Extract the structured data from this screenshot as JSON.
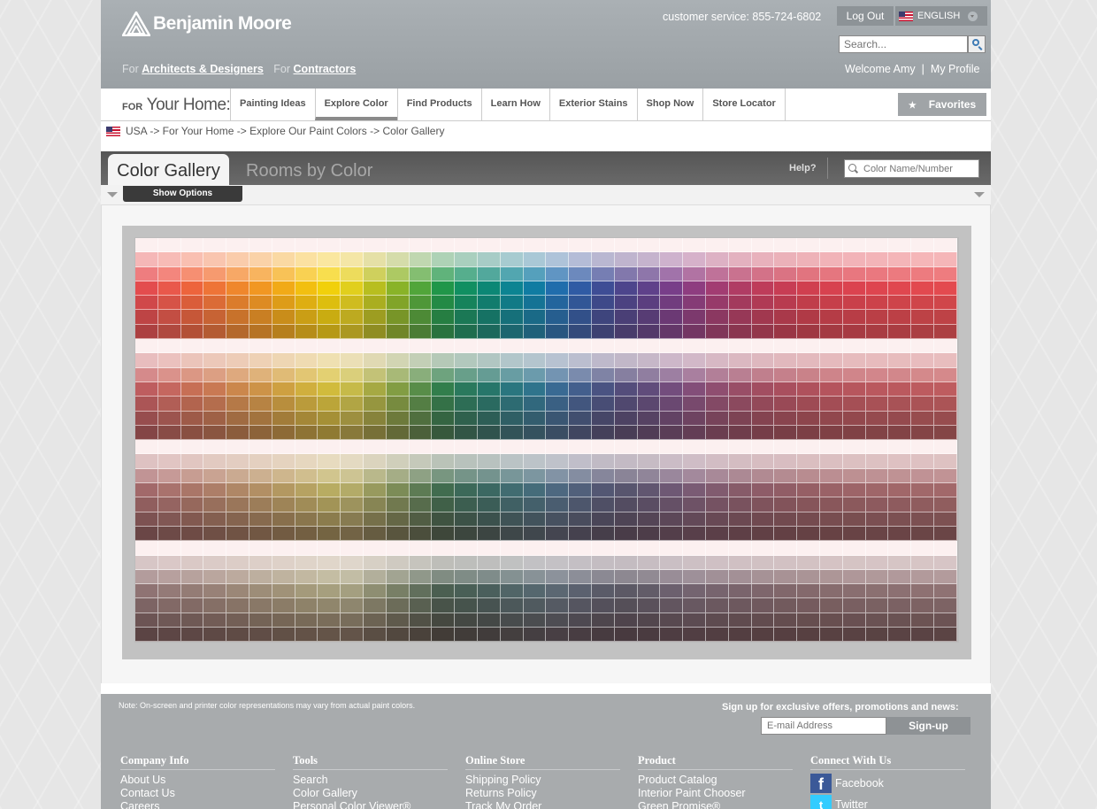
{
  "header": {
    "brand": "Benjamin Moore",
    "customer_service": "customer service: 855-724-6802",
    "logout": "Log Out",
    "language": "ENGLISH",
    "search_placeholder": "Search...",
    "for_prefix_1": "For",
    "for_link_1": "Architects & Designers",
    "for_prefix_2": "For",
    "for_link_2": "Contractors",
    "welcome": "Welcome Amy",
    "separator": "|",
    "profile": "My Profile"
  },
  "nav": {
    "for_small": "FOR",
    "for_big": "Your Home:",
    "tabs": [
      "Painting Ideas",
      "Explore Color",
      "Find Products",
      "Learn How",
      "Exterior Stains",
      "Shop Now",
      "Store Locator"
    ],
    "active_tab": "Explore Color",
    "favorites": "Favorites",
    "favorites_star": "★"
  },
  "breadcrumb": "USA -> For Your Home -> Explore Our Paint Colors -> Color Gallery",
  "gallery": {
    "tab_active": "Color Gallery",
    "tab_inactive": "Rooms by Color",
    "help": "Help?",
    "search_placeholder": "Color Name/Number",
    "show_options": "Show Options"
  },
  "palette": {
    "columns": 36,
    "rows": 28,
    "hue_ramp": [
      "#e84d4f",
      "#ef5a4c",
      "#f3663d",
      "#f47638",
      "#f58a2c",
      "#f79b22",
      "#f7ae16",
      "#f8c40f",
      "#f7d60a",
      "#e6d41d",
      "#bcc31f",
      "#8cb828",
      "#52a93b",
      "#1f9a4a",
      "#109263",
      "#0a8a78",
      "#0a8795",
      "#0f7fa6",
      "#1f6fb0",
      "#2f5da8",
      "#3e4e99",
      "#4e468f",
      "#60428d",
      "#7a3f8c",
      "#913e83",
      "#a53d74",
      "#b43d66",
      "#c23d5c",
      "#cc3e55",
      "#d54050",
      "#dc4350",
      "#e04450",
      "#e34650",
      "#e54850",
      "#e74a50",
      "#e84b50"
    ],
    "bands": [
      {
        "sat": 1.0,
        "dark": 0.0
      },
      {
        "sat": 0.65,
        "dark": 0.12
      },
      {
        "sat": 0.38,
        "dark": 0.22
      },
      {
        "sat": 0.18,
        "dark": 0.3
      }
    ]
  },
  "note": "Note: On-screen and printer color representations may vary from actual paint colors.",
  "signup": {
    "label": "Sign up for exclusive offers, promotions and news:",
    "email_placeholder": "E-mail Address",
    "button": "Sign-up"
  },
  "footer": {
    "company": {
      "title": "Company Info",
      "links": [
        "About Us",
        "Contact Us",
        "Careers"
      ]
    },
    "tools": {
      "title": "Tools",
      "links": [
        "Search",
        "Color Gallery",
        "Personal Color Viewer®"
      ]
    },
    "store": {
      "title": "Online Store",
      "links": [
        "Shipping Policy",
        "Returns Policy",
        "Track My Order"
      ]
    },
    "product": {
      "title": "Product",
      "links": [
        "Product Catalog",
        "Interior Paint Chooser",
        "Green Promise®"
      ]
    },
    "connect": {
      "title": "Connect With Us",
      "facebook": "Facebook",
      "twitter": "Twitter",
      "fb_icon": "f",
      "tw_icon": "t"
    }
  }
}
